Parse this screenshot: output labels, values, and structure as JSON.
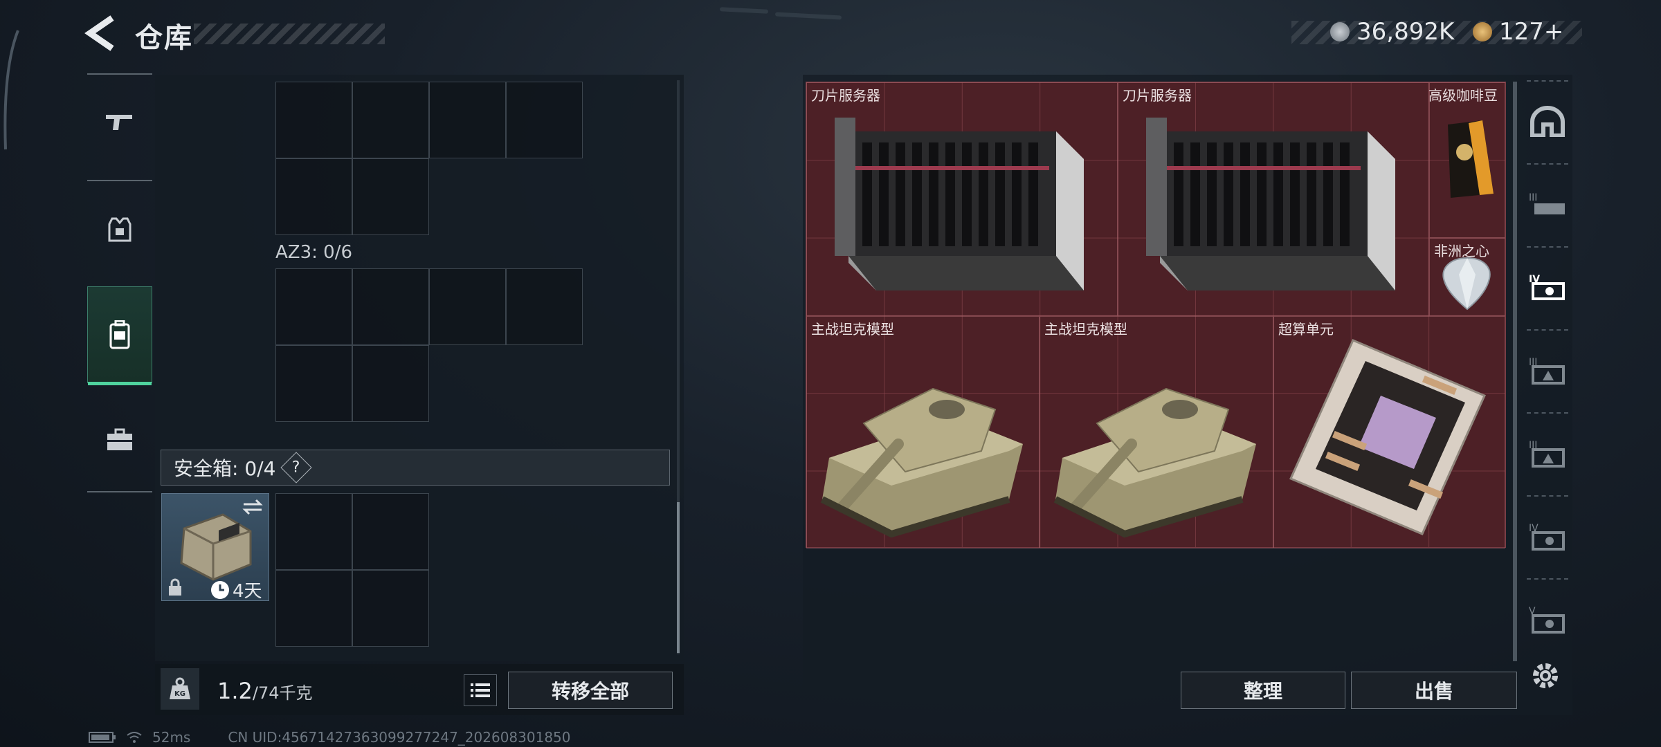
{
  "header": {
    "title": "仓库",
    "currency_1": "36,892K",
    "currency_2": "127+"
  },
  "left_rail": {
    "tabs": [
      {
        "icon": "gun-icon"
      },
      {
        "icon": "armor-vest-icon"
      },
      {
        "icon": "backpack-icon",
        "active": true
      },
      {
        "icon": "briefcase-icon"
      }
    ]
  },
  "left_panel": {
    "az3_label": "AZ3: 0/6",
    "safe_box_label": "安全箱: 0/4",
    "help": "?",
    "safe_case_timer": "4天",
    "weight_current": "1.2",
    "weight_capacity": "/74千克",
    "kg_icon_label": "KG",
    "transfer_all": "转移全部"
  },
  "stash": {
    "items": [
      {
        "name": "刀片服务器"
      },
      {
        "name": "刀片服务器"
      },
      {
        "name": "高级咖啡豆"
      },
      {
        "name": "非洲之心"
      },
      {
        "name": "主战坦克模型"
      },
      {
        "name": "主战坦克模型"
      },
      {
        "name": "超算单元"
      }
    ],
    "sort_button": "整理",
    "sell_button": "出售"
  },
  "right_rail": {
    "tabs": [
      "helmet-icon",
      "tier-3-item-icon",
      "tier-4-item-icon",
      "tier-3-case-icon",
      "tier-3-case-icon-2",
      "tier-4-case-icon",
      "tier-5-case-icon"
    ]
  },
  "status_bar": {
    "ping": "52ms",
    "uid": "CN UID:45671427363099277247_202608301850"
  },
  "colors": {
    "accent_green": "#4fd39e",
    "stash_red": "#4d2026"
  }
}
